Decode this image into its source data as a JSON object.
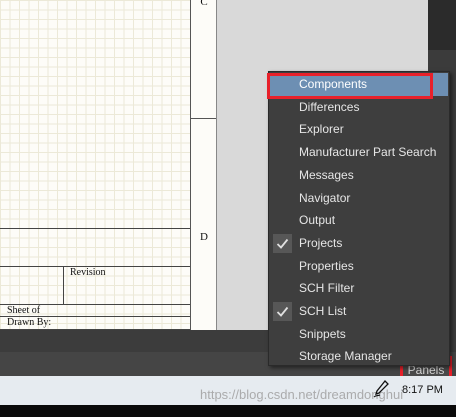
{
  "sheet": {
    "zone_labels": [
      "C",
      "D"
    ],
    "title_block": {
      "revision_label": "Revision",
      "sheet_label": "Sheet   of",
      "drawn_by_label": "Drawn By:"
    }
  },
  "panels_menu": {
    "items": [
      {
        "label": "Components",
        "checked": false,
        "highlighted": true
      },
      {
        "label": "Differences",
        "checked": false,
        "highlighted": false
      },
      {
        "label": "Explorer",
        "checked": false,
        "highlighted": false
      },
      {
        "label": "Manufacturer Part Search",
        "checked": false,
        "highlighted": false
      },
      {
        "label": "Messages",
        "checked": false,
        "highlighted": false
      },
      {
        "label": "Navigator",
        "checked": false,
        "highlighted": false
      },
      {
        "label": "Output",
        "checked": false,
        "highlighted": false
      },
      {
        "label": "Projects",
        "checked": true,
        "highlighted": false
      },
      {
        "label": "Properties",
        "checked": false,
        "highlighted": false
      },
      {
        "label": "SCH Filter",
        "checked": false,
        "highlighted": false
      },
      {
        "label": "SCH List",
        "checked": true,
        "highlighted": false
      },
      {
        "label": "Snippets",
        "checked": false,
        "highlighted": false
      },
      {
        "label": "Storage Manager",
        "checked": false,
        "highlighted": false
      }
    ]
  },
  "status_bar": {
    "panels_button_label": "Panels"
  },
  "taskbar": {
    "watermark": "https://blog.csdn.net/dreamdonghui",
    "clock": "8:17 PM",
    "icons": [
      "pen-icon"
    ]
  },
  "colors": {
    "menu_bg": "#3e3e3e",
    "menu_highlight": "#6d8fb3",
    "annotation_red": "#e8202a"
  }
}
